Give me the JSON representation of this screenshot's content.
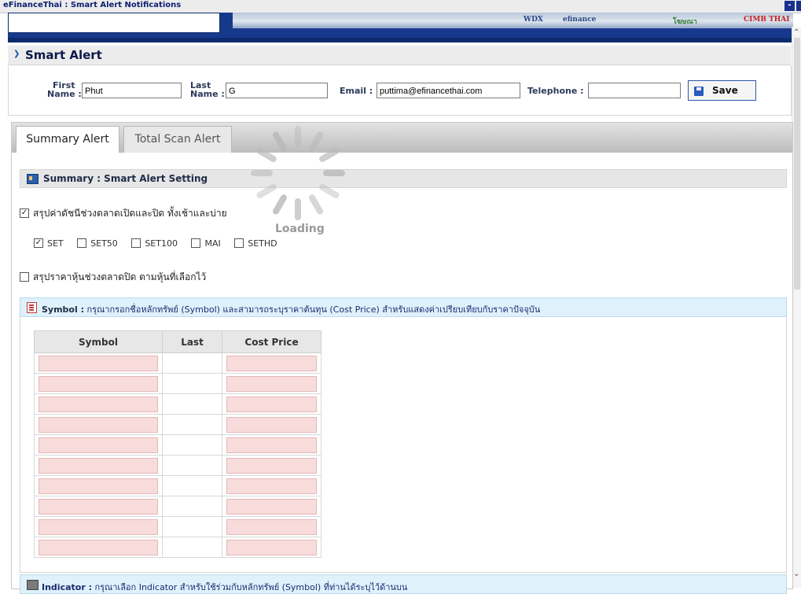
{
  "window": {
    "title": "eFinanceThai : Smart Alert Notifications",
    "minimize_glyph": "-",
    "colors": {
      "titlebar_text": "#0b1e6f",
      "banner": "#17398c"
    }
  },
  "banner": {
    "logos": [
      {
        "text": "WDX",
        "color": "#2a4685"
      },
      {
        "text": "efinance",
        "color": "#2a4685"
      },
      {
        "text": "โฆษณา",
        "color": "#2f7d35"
      },
      {
        "text": "CIMB THAI",
        "color": "#c62222"
      }
    ]
  },
  "header": {
    "title": "Smart Alert",
    "arrow_icon": "chevron-right-icon"
  },
  "form": {
    "first_name_label": "First",
    "first_name_label2": "Name :",
    "first_name_value": "Phut",
    "last_name_label": "Last",
    "last_name_label2": "Name :",
    "last_name_value": "G",
    "email_label": "Email :",
    "email_value": "puttima@efinancethai.com",
    "telephone_label": "Telephone :",
    "telephone_value": "",
    "save_label": "Save"
  },
  "tabs": [
    {
      "label": "Summary Alert",
      "active": true
    },
    {
      "label": "Total Scan Alert",
      "active": false
    }
  ],
  "summary": {
    "title": "Summary : Smart Alert Setting",
    "opt1_label": "สรุปค่าดัชนีช่วงตลาดเปิดและปิด ทั้งเช้าและบ่าย",
    "opt1_checked": true,
    "indices": [
      {
        "label": "SET",
        "checked": true
      },
      {
        "label": "SET50",
        "checked": false
      },
      {
        "label": "SET100",
        "checked": false
      },
      {
        "label": "MAI",
        "checked": false
      },
      {
        "label": "SETHD",
        "checked": false
      }
    ],
    "opt2_label": "สรุปราคาหุ้นช่วงตลาดปิด ตามหุ้นที่เลือกไว้",
    "opt2_checked": false
  },
  "symbol": {
    "title_bold": "Symbol :",
    "title_rest": " กรุณากรอกชื่อหลักทรัพย์ (Symbol) และสามารถระบุราคาต้นทุน (Cost Price) สำหรับแสดงค่าเปรียบเทียบกับราคาปัจจุบัน",
    "columns": [
      "Symbol",
      "Last",
      "Cost Price"
    ],
    "rows": 10
  },
  "indicator": {
    "title_bold": "Indicator :",
    "title_rest": " กรุณาเลือก Indicator สำหรับใช้ร่วมกับหลักทรัพย์ (Symbol) ที่ท่านได้ระบุไว้ด้านบน"
  },
  "loading": {
    "text": "Loading"
  }
}
